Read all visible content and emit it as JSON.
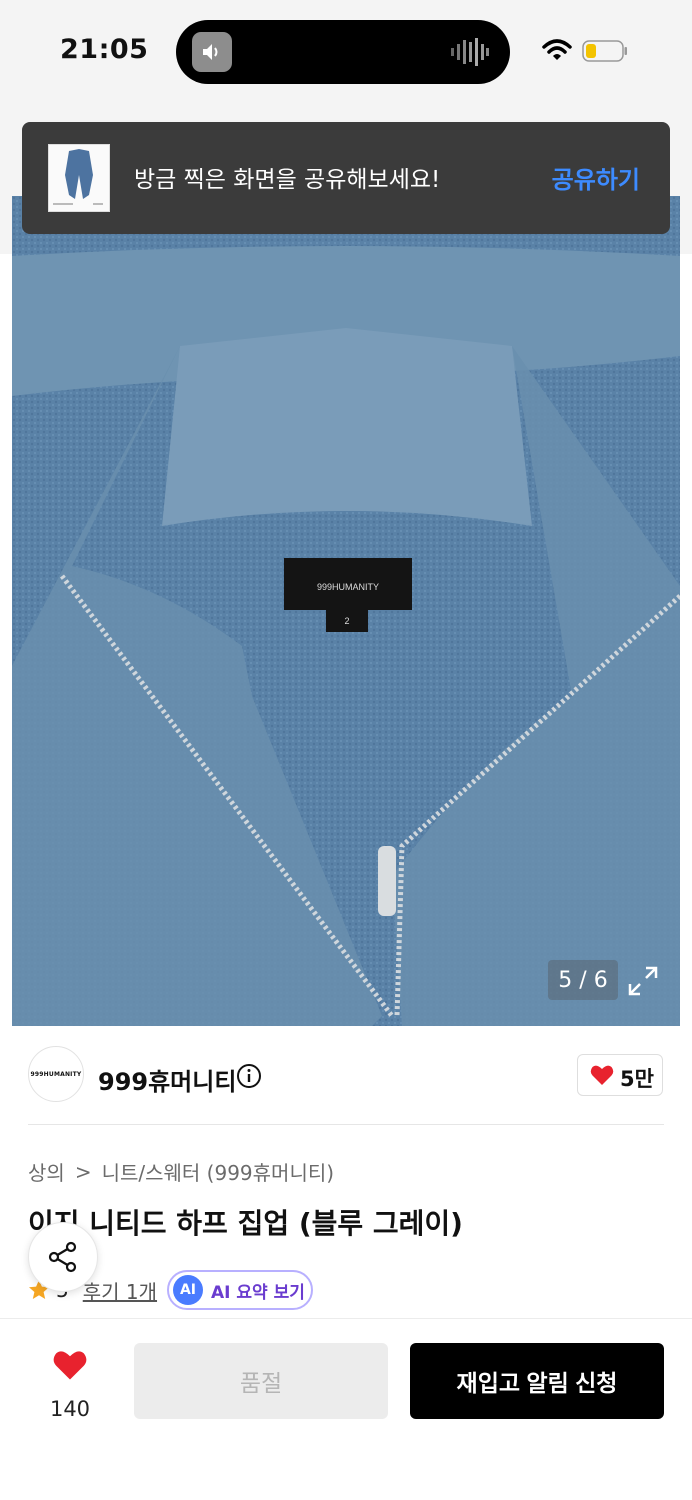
{
  "status_bar": {
    "time": "21:05"
  },
  "toast": {
    "message": "방금 찍은 화면을 공유해보세요!",
    "action_label": "공유하기"
  },
  "gallery": {
    "pagination": "5 / 6",
    "label_text": "999HUMANITY",
    "label_size": "2"
  },
  "brand": {
    "logo_text": "999HUMANITY",
    "name": "999휴머니티",
    "likes": "5만"
  },
  "breadcrumb": {
    "category": "상의",
    "separator": ">",
    "subcategory": "니트/스웨터 (999휴머니티)"
  },
  "product": {
    "title": "이지 니티드 하프 집업 (블루 그레이)"
  },
  "rating": {
    "score": "5",
    "reviews": "후기 1개",
    "ai_badge": "AI",
    "ai_label": "AI 요약 보기"
  },
  "bottom_bar": {
    "likes": "140",
    "soldout_label": "품절",
    "restock_label": "재입고 알림 신청"
  },
  "colors": {
    "accent_blue": "#3d8bff",
    "heart_red": "#e8222e",
    "ai_purple": "#6a3ccf"
  }
}
